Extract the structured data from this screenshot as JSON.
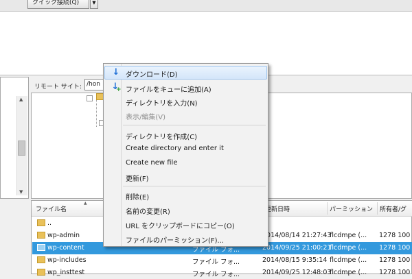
{
  "toolbar": {
    "quickconnect_label": "クイック接続(Q)",
    "dropdown_glyph": "▼"
  },
  "remote": {
    "site_label": "リモート サイト:",
    "path_value": "/hon"
  },
  "file_list": {
    "columns": [
      "ファイル名",
      "更新日時",
      "パーミッション",
      "所有者/グ"
    ],
    "rows": [
      {
        "name": "..",
        "type": "",
        "modified": "",
        "permissions": "",
        "owner": "",
        "selected": false
      },
      {
        "name": "wp-admin",
        "type": "",
        "modified": "2014/08/14 21:27:43",
        "permissions": "flcdmpe (...",
        "owner": "1278 100",
        "selected": false
      },
      {
        "name": "wp-content",
        "type": "ファイル フォ...",
        "modified": "2014/09/25 21:00:21",
        "permissions": "flcdmpe (...",
        "owner": "1278 100",
        "selected": true
      },
      {
        "name": "wp-includes",
        "type": "ファイル フォ...",
        "modified": "2014/08/15 9:35:14",
        "permissions": "flcdmpe (...",
        "owner": "1278 100",
        "selected": false
      },
      {
        "name": "wp_insttest",
        "type": "ファイル フォ...",
        "modified": "2014/09/25 12:48:03",
        "permissions": "flcdmpe (...",
        "owner": "1278 100",
        "selected": false
      }
    ]
  },
  "context_menu": {
    "download": "ダウンロード(D)",
    "add_to_queue": "ファイルをキューに追加(A)",
    "enter_directory": "ディレクトリを入力(N)",
    "view_edit": "表示/編集(V)",
    "create_directory": "ディレクトリを作成(C)",
    "create_directory_enter": "Create directory and enter it",
    "create_new_file": "Create new file",
    "refresh": "更新(F)",
    "delete": "削除(E)",
    "rename": "名前の変更(R)",
    "copy_url": "URL をクリップボードにコピー(O)",
    "file_permissions": "ファイルのパーミッション(F)..."
  },
  "icons": {
    "download": "download-arrow-icon",
    "add_queue": "queue-add-icon",
    "folder": "folder-icon"
  },
  "colors": {
    "selection": "#3399dd",
    "menu_highlight": "#d4e6fa",
    "folder": "#e9c15a"
  }
}
